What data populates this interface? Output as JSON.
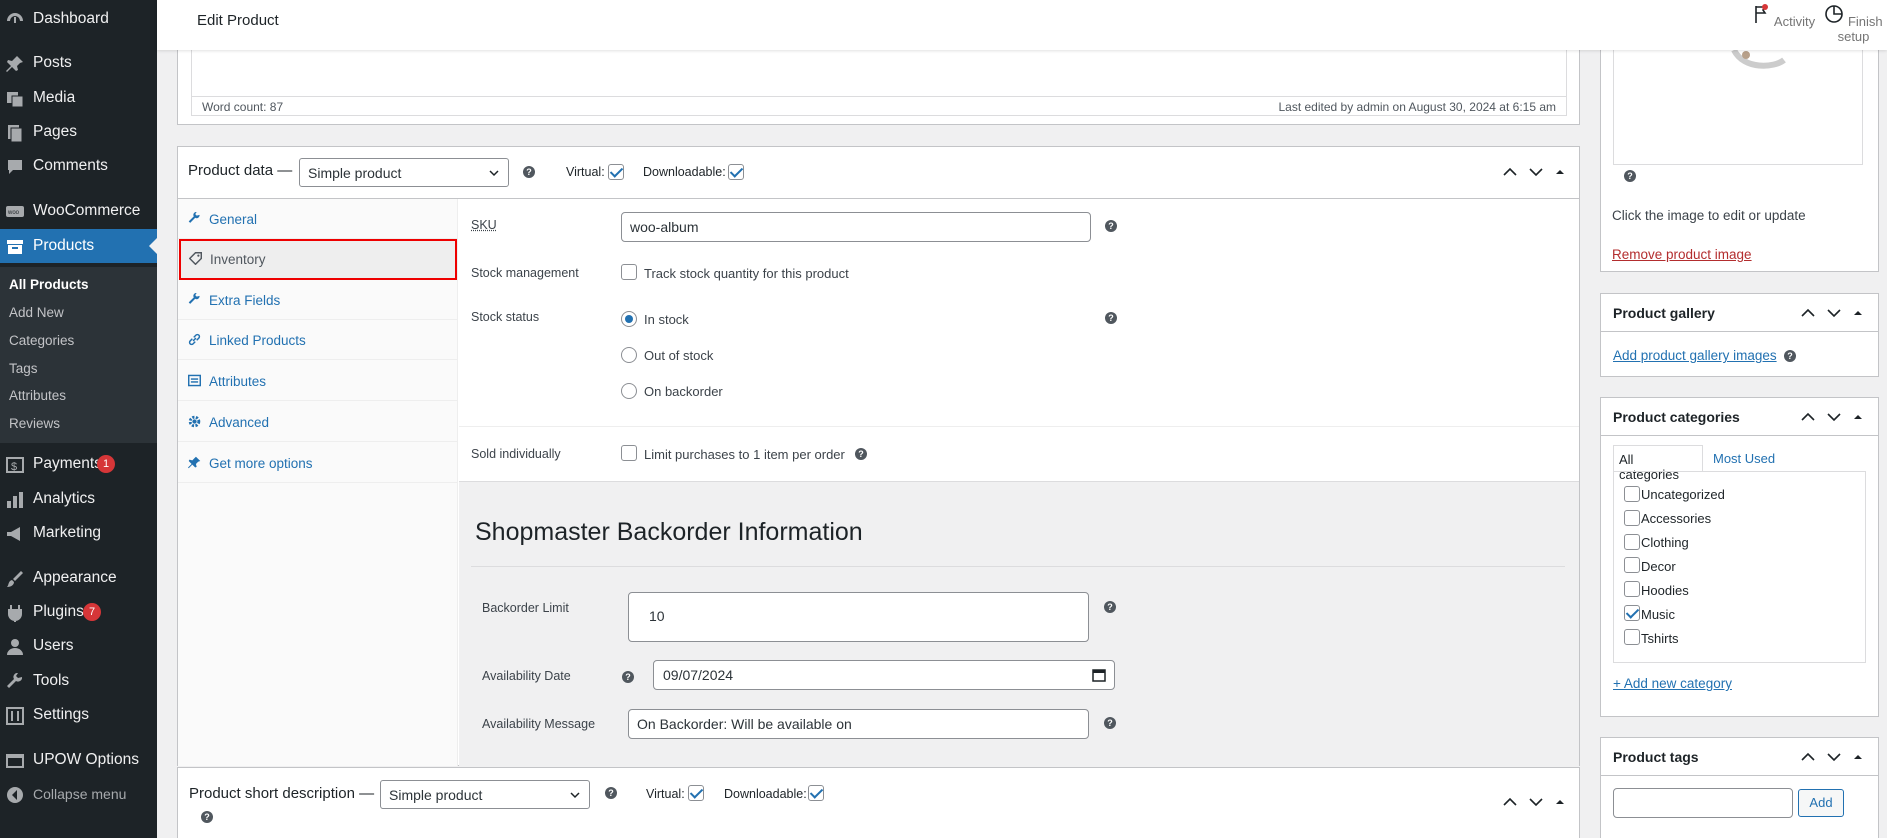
{
  "sidebar": {
    "items": [
      {
        "label": "Dashboard",
        "icon": "dashboard-icon"
      },
      {
        "label": "Posts",
        "icon": "pin-icon"
      },
      {
        "label": "Media",
        "icon": "media-icon"
      },
      {
        "label": "Pages",
        "icon": "pages-icon"
      },
      {
        "label": "Comments",
        "icon": "comment-icon"
      },
      {
        "label": "WooCommerce",
        "icon": "woo-icon"
      },
      {
        "label": "Products",
        "icon": "archive-icon"
      },
      {
        "label": "Payments",
        "icon": "dollar-icon",
        "badge": "1"
      },
      {
        "label": "Analytics",
        "icon": "bar-chart-icon"
      },
      {
        "label": "Marketing",
        "icon": "megaphone-icon"
      },
      {
        "label": "Appearance",
        "icon": "brush-icon"
      },
      {
        "label": "Plugins",
        "icon": "plug-icon",
        "badge": "7"
      },
      {
        "label": "Users",
        "icon": "user-icon"
      },
      {
        "label": "Tools",
        "icon": "wrench-icon"
      },
      {
        "label": "Settings",
        "icon": "settings-icon"
      },
      {
        "label": "UPOW Options",
        "icon": "options-icon"
      },
      {
        "label": "Collapse menu",
        "icon": "collapse-icon"
      }
    ],
    "submenu": [
      "All Products",
      "Add New",
      "Categories",
      "Tags",
      "Attributes",
      "Reviews"
    ]
  },
  "topbar": {
    "title": "Edit Product",
    "activity": "Activity",
    "finish_setup": "Finish setup"
  },
  "editor": {
    "word_count": "Word count: 87",
    "last_edited": "Last edited by admin on August 30, 2024 at 6:15 am"
  },
  "product_data": {
    "title": "Product data —",
    "type": "Simple product",
    "virtual": "Virtual:",
    "downloadable": "Downloadable:",
    "tabs": [
      "General",
      "Inventory",
      "Extra Fields",
      "Linked Products",
      "Attributes",
      "Advanced",
      "Get more options"
    ],
    "sku_label": "SKU",
    "sku_value": "woo-album",
    "stock_mgmt_label": "Stock management",
    "stock_mgmt_text": "Track stock quantity for this product",
    "stock_status_label": "Stock status",
    "stock_options": [
      "In stock",
      "Out of stock",
      "On backorder"
    ],
    "sold_ind_label": "Sold individually",
    "sold_ind_text": "Limit purchases to 1 item per order"
  },
  "shopmaster": {
    "title": "Shopmaster Backorder Information",
    "limit_label": "Backorder Limit",
    "limit_value": "10",
    "date_label": "Availability Date",
    "date_value": "09/07/2024",
    "message_label": "Availability Message",
    "message_value": "On Backorder: Will be available on"
  },
  "short_desc": {
    "title": "Product short description —",
    "type": "Simple product",
    "virtual": "Virtual:",
    "downloadable": "Downloadable:"
  },
  "right": {
    "image_help": "Click the image to edit or update",
    "remove_image": "Remove product image",
    "gallery_title": "Product gallery",
    "gallery_link": "Add product gallery images",
    "categories_title": "Product categories",
    "cat_tab_all": "All categories",
    "cat_tab_used": "Most Used",
    "categories": [
      {
        "name": "Uncategorized",
        "checked": false
      },
      {
        "name": "Accessories",
        "checked": false
      },
      {
        "name": "Clothing",
        "checked": false
      },
      {
        "name": "Decor",
        "checked": false
      },
      {
        "name": "Hoodies",
        "checked": false
      },
      {
        "name": "Music",
        "checked": true
      },
      {
        "name": "Tshirts",
        "checked": false
      }
    ],
    "add_category": "+ Add new category",
    "tags_title": "Product tags",
    "tags_add": "Add"
  },
  "colors": {
    "sidebar": "#1d2327",
    "accent": "#2271b1",
    "badge": "#d63638",
    "highlight": "#e00000"
  }
}
